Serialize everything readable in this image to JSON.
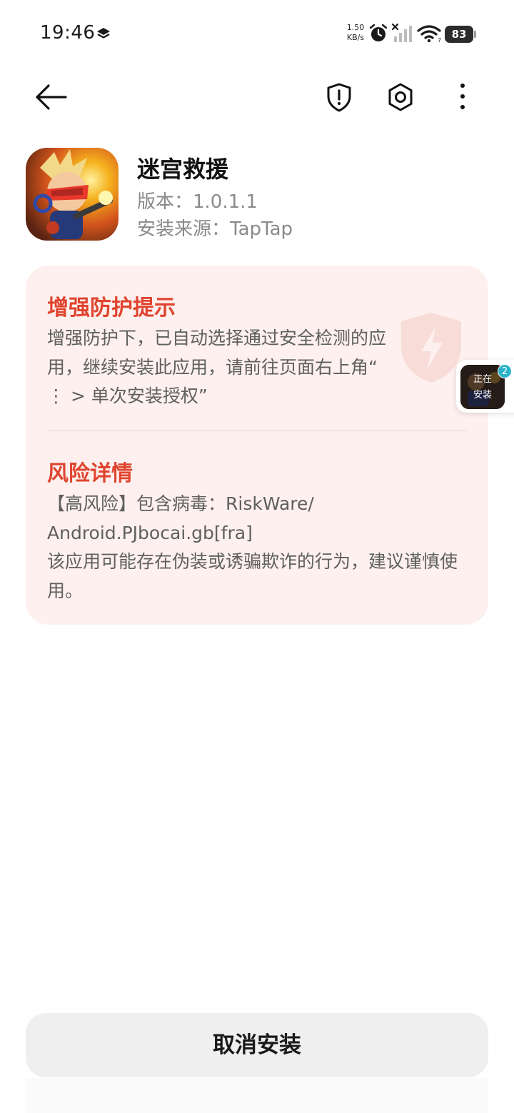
{
  "status_bar": {
    "time": "19:46",
    "net_speed_value": "1.50",
    "net_speed_unit": "KB/s",
    "wifi_sub": "7",
    "battery": "83"
  },
  "toolbar": {
    "back_icon": "arrow-left-icon",
    "shield_icon": "shield-alert-icon",
    "settings_icon": "hexagon-gear-icon",
    "more_icon": "more-vertical-icon"
  },
  "app": {
    "name": "迷宫救援",
    "version": "版本：1.0.1.1",
    "source": "安装来源：TapTap"
  },
  "warning": {
    "protect_title": "增强防护提示",
    "protect_body": "增强防护下，已自动选择通过安全检测的应用，继续安装此应用，请前往页面右上角“ ⋮ > 单次安装授权”",
    "risk_title": "风险详情",
    "risk_line1": "【高风险】包含病毒：RiskWare/",
    "risk_line2": "Android.PJbocai.gb[fra]",
    "risk_line3": "该应用可能存在伪装或诱骗欺诈的行为，建议谨慎使用。",
    "accent_color": "#e0442f",
    "card_color": "#fdf0ee"
  },
  "floating": {
    "label_line1": "正在",
    "label_line2": "安装",
    "badge": "2"
  },
  "actions": {
    "cancel_label": "取消安装"
  }
}
